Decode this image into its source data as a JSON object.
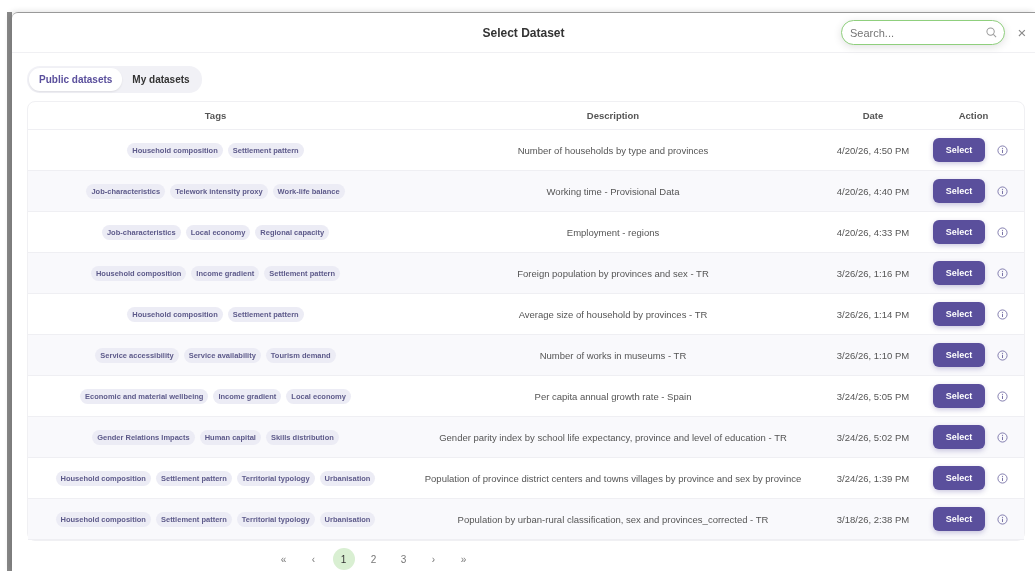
{
  "dialog": {
    "title": "Select Dataset",
    "search": {
      "placeholder": "Search..."
    },
    "close": "×"
  },
  "tabs": [
    {
      "label": "Public datasets",
      "selected": true
    },
    {
      "label": "My datasets",
      "selected": false
    }
  ],
  "table": {
    "columns": [
      "Tags",
      "Description",
      "Date",
      "Action"
    ],
    "rows": [
      {
        "tags": [
          "Household composition",
          "Settlement pattern"
        ],
        "description": "Number of households by type and provinces",
        "date": "4/20/26, 4:50 PM",
        "action": "Select"
      },
      {
        "tags": [
          "Job-characteristics",
          "Telework intensity proxy",
          "Work-life balance"
        ],
        "description": "Working time - Provisional Data",
        "date": "4/20/26, 4:40 PM",
        "action": "Select"
      },
      {
        "tags": [
          "Job-characteristics",
          "Local economy",
          "Regional capacity"
        ],
        "description": "Employment - regions",
        "date": "4/20/26, 4:33 PM",
        "action": "Select"
      },
      {
        "tags": [
          "Household composition",
          "Income gradient",
          "Settlement pattern"
        ],
        "description": "Foreign population by provinces and sex - TR",
        "date": "3/26/26, 1:16 PM",
        "action": "Select"
      },
      {
        "tags": [
          "Household composition",
          "Settlement pattern"
        ],
        "description": "Average size of household by provinces - TR",
        "date": "3/26/26, 1:14 PM",
        "action": "Select"
      },
      {
        "tags": [
          "Service accessibility",
          "Service availability",
          "Tourism demand"
        ],
        "description": "Number of works in museums - TR",
        "date": "3/26/26, 1:10 PM",
        "action": "Select"
      },
      {
        "tags": [
          "Economic and material wellbeing",
          "Income gradient",
          "Local economy"
        ],
        "description": "Per capita annual growth rate - Spain",
        "date": "3/24/26, 5:05 PM",
        "action": "Select"
      },
      {
        "tags": [
          "Gender Relations Impacts",
          "Human capital",
          "Skills distribution"
        ],
        "description": "Gender parity index by school life expectancy, province and level of education - TR",
        "date": "3/24/26, 5:02 PM",
        "action": "Select"
      },
      {
        "tags": [
          "Household composition",
          "Settlement pattern",
          "Territorial typology",
          "Urbanisation"
        ],
        "description": "Population of province district centers and towns villages by province and sex by province",
        "date": "3/24/26, 1:39 PM",
        "action": "Select"
      },
      {
        "tags": [
          "Household composition",
          "Settlement pattern",
          "Territorial typology",
          "Urbanisation"
        ],
        "description": "Population by urban-rural classification, sex and provinces_corrected - TR",
        "date": "3/18/26, 2:38 PM",
        "action": "Select"
      }
    ]
  },
  "pagination": [
    {
      "label": "«",
      "selected": false
    },
    {
      "label": "‹",
      "selected": false
    },
    {
      "label": "1",
      "selected": true
    },
    {
      "label": "2",
      "selected": false
    },
    {
      "label": "3",
      "selected": false
    },
    {
      "label": "›",
      "selected": false
    },
    {
      "label": "»",
      "selected": false
    }
  ]
}
